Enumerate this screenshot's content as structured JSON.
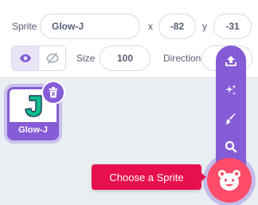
{
  "sprite_info": {
    "sprite_label": "Sprite",
    "sprite_name": "Glow-J",
    "x_label": "x",
    "x_value": "-82",
    "y_label": "y",
    "y_value": "-31",
    "show_label": "Show",
    "size_label": "Size",
    "size_value": "100",
    "direction_label": "Direction"
  },
  "sprite_list": {
    "items": [
      {
        "name": "Glow-J",
        "selected": true
      }
    ]
  },
  "sprite_menu": {
    "tooltip": "Choose a Sprite",
    "items": [
      {
        "icon": "upload-icon",
        "label": "Upload Sprite"
      },
      {
        "icon": "surprise-icon",
        "label": "Surprise"
      },
      {
        "icon": "paint-icon",
        "label": "Paint"
      },
      {
        "icon": "search-icon",
        "label": "Choose a Sprite"
      }
    ],
    "main_icon": "sprite-bear-icon"
  },
  "colors": {
    "accent": "#855cd6",
    "tooltip": "#e6104d",
    "main_button": "#ff4c6a",
    "glow_j": "#0fbd8c"
  }
}
